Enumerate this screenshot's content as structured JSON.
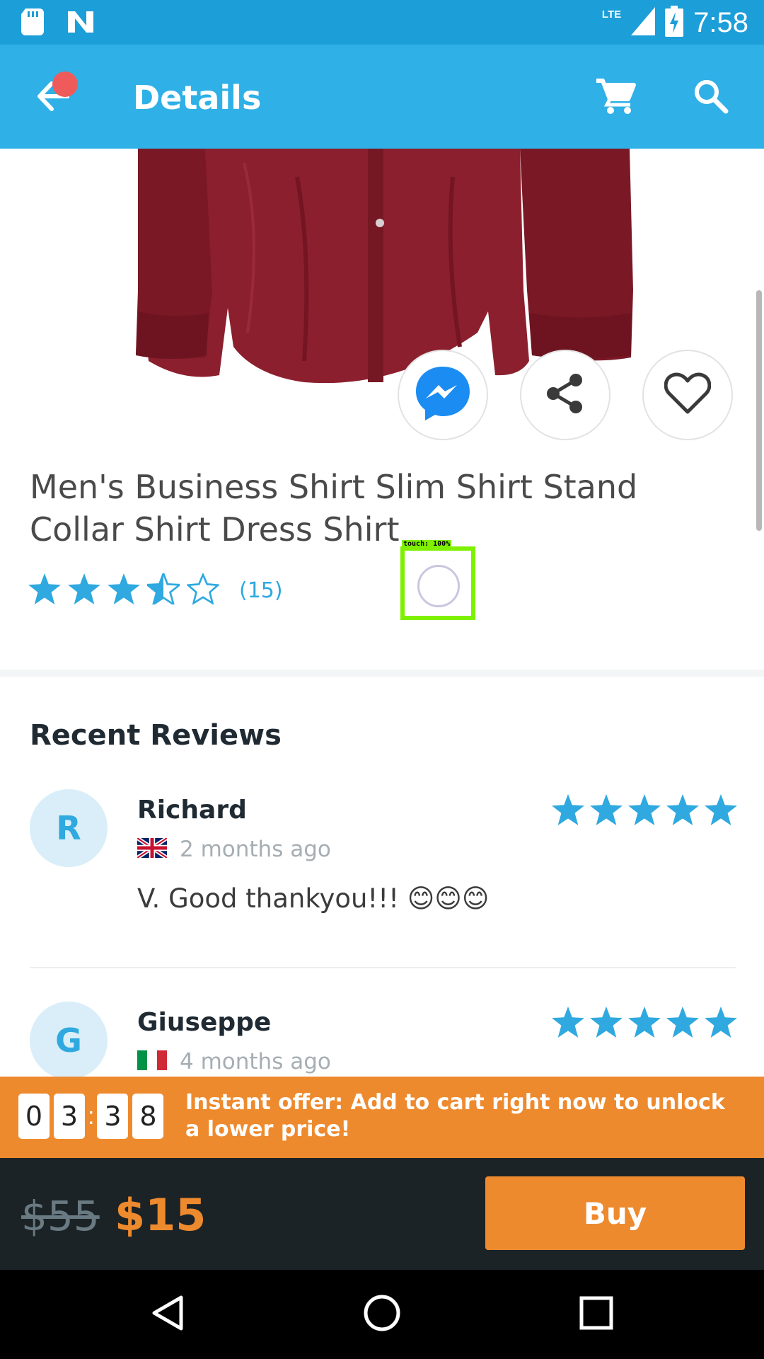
{
  "status_bar": {
    "time": "7:58",
    "network": "LTE",
    "icons": [
      "sd-card-icon",
      "n-notification-icon",
      "lte-signal-icon",
      "battery-charging-icon"
    ]
  },
  "app_bar": {
    "title": "Details",
    "icons": [
      "back-arrow-icon",
      "cart-icon",
      "search-icon"
    ],
    "background": "#2fb0e6",
    "notification_dot_color": "#ef5b5b"
  },
  "product": {
    "title": "Men's Business Shirt Slim Shirt Stand Collar Shirt Dress Shirt",
    "rating": 3.5,
    "rating_max": 5,
    "rating_count": "(15)",
    "actions": [
      "messenger-icon",
      "share-icon",
      "heart-icon"
    ],
    "image_description_color": "#8c1f2e"
  },
  "touch_indicator": {
    "label": "touch: 100%"
  },
  "reviews": {
    "heading": "Recent Reviews",
    "items": [
      {
        "initial": "R",
        "name": "Richard",
        "flag": "uk-flag-icon",
        "date": "2 months ago",
        "stars": 5,
        "text": "V. Good thankyou!!! 😊😊😊"
      },
      {
        "initial": "G",
        "name": "Giuseppe",
        "flag": "italy-flag-icon",
        "date": "4 months ago",
        "stars": 5,
        "text": ""
      }
    ]
  },
  "offer": {
    "timer_digits": [
      "0",
      "3",
      "3",
      "8"
    ],
    "text": "Instant offer: Add to cart right now to unlock a lower price!",
    "color": "#ee8a2e"
  },
  "buy_bar": {
    "old_price": "$55",
    "new_price": "$15",
    "buy_label": "Buy"
  },
  "colors": {
    "accent": "#2fa9df",
    "star": "#2fa9df",
    "offer": "#ee8a2e"
  }
}
